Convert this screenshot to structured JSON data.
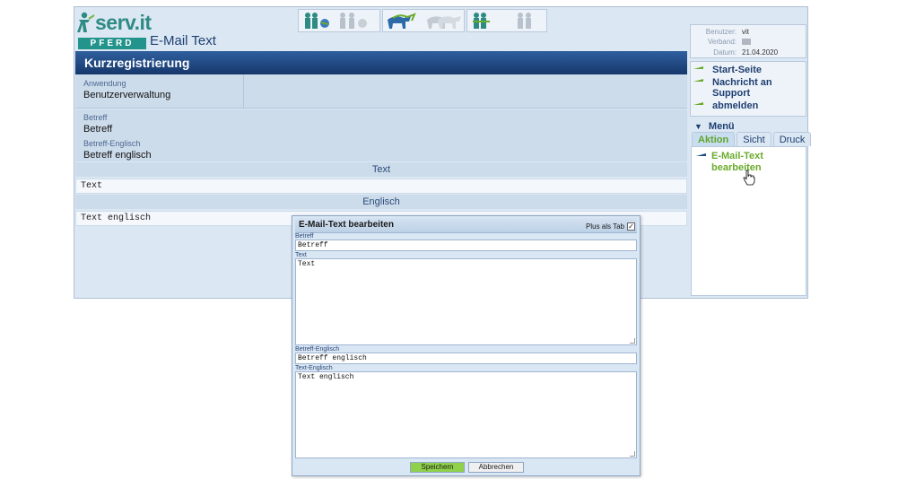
{
  "header": {
    "logo_text": "serv.it",
    "logo_band": "PFERD",
    "page_title": "E-Mail Text"
  },
  "banner": {
    "title": "Kurzregistrierung"
  },
  "fields": {
    "anwendung_label": "Anwendung",
    "anwendung_value": "Benutzerverwaltung",
    "betreff_label": "Betreff",
    "betreff_value": "Betreff",
    "betreff_en_label": "Betreff-Englisch",
    "betreff_en_value": "Betreff englisch"
  },
  "sections": {
    "text_header": "Text",
    "text_body": "Text",
    "englisch_header": "Englisch",
    "englisch_body": "Text englisch"
  },
  "user_info": {
    "benutzer_label": "Benutzer:",
    "benutzer_value": "vit",
    "verband_label": "Verband:",
    "datum_label": "Datum:",
    "datum_value": "21.04.2020"
  },
  "nav": {
    "start": "Start-Seite",
    "support": "Nachricht an Support",
    "logout": "abmelden"
  },
  "menu": {
    "title": "Menü",
    "tabs": [
      "Aktion",
      "Sicht",
      "Druck"
    ],
    "action_item": "E-Mail-Text bearbeiten"
  },
  "dialog": {
    "title": "E-Mail-Text bearbeiten",
    "plus_tab_label": "Plus als Tab",
    "plus_tab_checked": true,
    "betreff_label": "Betreff",
    "betreff_value": "Betreff",
    "text_label": "Text",
    "text_value": "Text",
    "betreff_en_label": "Betreff-Englisch",
    "betreff_en_value": "Betreff englisch",
    "text_en_label": "Text-Englisch",
    "text_en_value": "Text englisch",
    "save_label": "Speichern",
    "cancel_label": "Abbrechen"
  },
  "colors": {
    "accent_green": "#6aab2c",
    "banner_blue": "#1f4a85",
    "logo_teal": "#23948c"
  }
}
